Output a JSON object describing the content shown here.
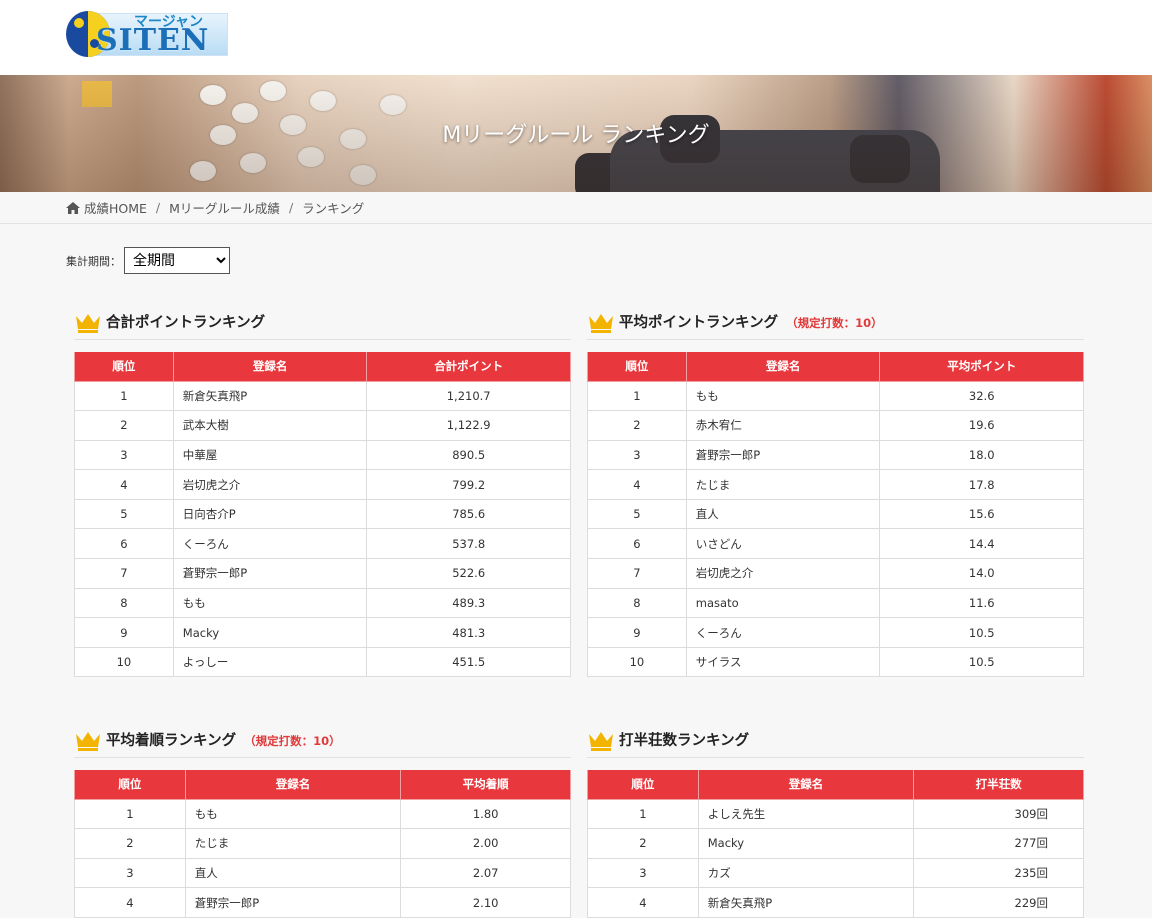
{
  "logo": {
    "kana": "マージャン",
    "brand": "SITEN"
  },
  "hero": {
    "title": "Mリーグルール ランキング"
  },
  "breadcrumb": {
    "items": [
      "成績HOME",
      "Mリーグルール成績",
      "ランキング"
    ]
  },
  "period": {
    "label": "集計期間：",
    "selected": "全期間"
  },
  "tables": [
    {
      "title": "合計ポイントランキング",
      "note": "",
      "headers": [
        "順位",
        "登録名",
        "合計ポイント"
      ],
      "rows": [
        [
          "1",
          "新倉矢真飛P",
          "1,210.7"
        ],
        [
          "2",
          "武本大樹",
          "1,122.9"
        ],
        [
          "3",
          "中華屋",
          "890.5"
        ],
        [
          "4",
          "岩切虎之介",
          "799.2"
        ],
        [
          "5",
          "日向杏介P",
          "785.6"
        ],
        [
          "6",
          "くーろん",
          "537.8"
        ],
        [
          "7",
          "蒼野宗一郎P",
          "522.6"
        ],
        [
          "8",
          "もも",
          "489.3"
        ],
        [
          "9",
          "Macky",
          "481.3"
        ],
        [
          "10",
          "よっしー",
          "451.5"
        ]
      ]
    },
    {
      "title": "平均ポイントランキング",
      "note": "（規定打数：10）",
      "headers": [
        "順位",
        "登録名",
        "平均ポイント"
      ],
      "rows": [
        [
          "1",
          "もも",
          "32.6"
        ],
        [
          "2",
          "赤木宥仁",
          "19.6"
        ],
        [
          "3",
          "蒼野宗一郎P",
          "18.0"
        ],
        [
          "4",
          "たじま",
          "17.8"
        ],
        [
          "5",
          "直人",
          "15.6"
        ],
        [
          "6",
          "いさどん",
          "14.4"
        ],
        [
          "7",
          "岩切虎之介",
          "14.0"
        ],
        [
          "8",
          "masato",
          "11.6"
        ],
        [
          "9",
          "くーろん",
          "10.5"
        ],
        [
          "10",
          "サイラス",
          "10.5"
        ]
      ]
    },
    {
      "title": "平均着順ランキング",
      "note": "（規定打数：10）",
      "headers": [
        "順位",
        "登録名",
        "平均着順"
      ],
      "rows": [
        [
          "1",
          "もも",
          "1.80"
        ],
        [
          "2",
          "たじま",
          "2.00"
        ],
        [
          "3",
          "直人",
          "2.07"
        ],
        [
          "4",
          "蒼野宗一郎P",
          "2.10"
        ]
      ]
    },
    {
      "title": "打半荘数ランキング",
      "note": "",
      "headers": [
        "順位",
        "登録名",
        "打半荘数"
      ],
      "rows": [
        [
          "1",
          "よしえ先生",
          "309回"
        ],
        [
          "2",
          "Macky",
          "277回"
        ],
        [
          "3",
          "カズ",
          "235回"
        ],
        [
          "4",
          "新倉矢真飛P",
          "229回"
        ]
      ]
    }
  ],
  "colors": {
    "accent": "#e8383d",
    "note": "#e03a3a"
  }
}
